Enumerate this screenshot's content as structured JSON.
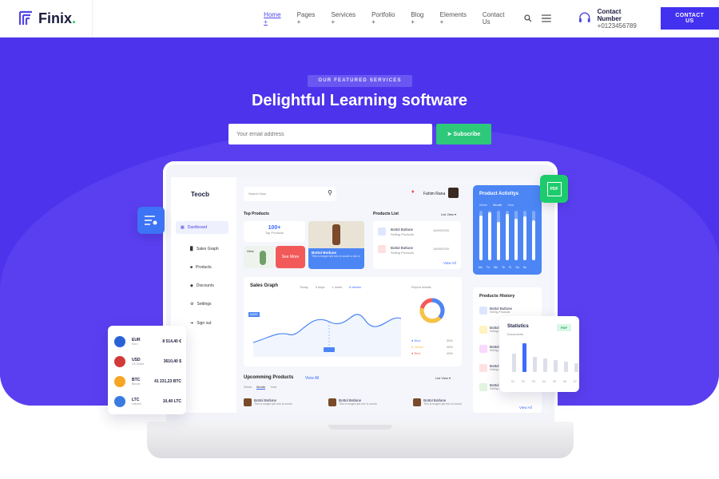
{
  "nav": {
    "brand": "Finix",
    "brand_dot": ".",
    "items": [
      "Home +",
      "Pages +",
      "Services +",
      "Portfolio +",
      "Blog +",
      "Elements +",
      "Contact Us"
    ],
    "contact_title": "Contact Number",
    "contact_phone": "+0123456789",
    "cta": "CONTACT US"
  },
  "hero": {
    "badge": "OUR FEATURED SERVICES",
    "title": "Delightful Learning software",
    "email_placeholder": "Your email address",
    "subscribe": "Subscribe"
  },
  "dash": {
    "brand": "Teocb",
    "sidebar": [
      "Dashboard",
      "Sales Graph",
      "Products",
      "Discounts",
      "Settings",
      "Sign out"
    ],
    "search": "Search Now",
    "user": "Fahim Rana",
    "top_products": "Top Products",
    "top_count": "100+",
    "top_label": "Top Products",
    "view_btn": "View",
    "see_more": "See More",
    "bottle_title": "Bottol Botlune",
    "bottle_desc": "This is tosgeo ipb tolo is sourlo a tolo is",
    "products_list": "Products List",
    "list_view": "List View",
    "list_items": [
      {
        "name": "Bottol Botlune",
        "sub": "Selling Products",
        "date": "16/09/2020"
      },
      {
        "name": "Bottol Botlune",
        "sub": "Selling Products",
        "date": "16/09/2020"
      }
    ],
    "view_all": "View All",
    "sales_graph": "Sales Graph",
    "sales_tabs": [
      "Today",
      "3 days",
      "1 week",
      "6 weeks"
    ],
    "value_label": "$4800",
    "legend": [
      "Blue",
      "Yellow",
      "Red"
    ],
    "legend_pct": [
      "35%",
      "45%",
      "45%"
    ],
    "report": "Report details",
    "upcoming": "Upcomming Products",
    "upcoming_view_all": "View All",
    "upcoming_tabs": [
      "Week",
      "Month",
      "Year"
    ],
    "upcoming_items": [
      "Bottol Botlune",
      "Bottol Botlune",
      "Bottol Botlune"
    ],
    "upcoming_desc": "This is tosgeo ipb tolo is sourlo",
    "activity": "Product Activitys",
    "activity_tabs": [
      "Week",
      "Month",
      "Year"
    ],
    "activity_days": [
      "Mo",
      "Tu",
      "We",
      "Th",
      "Fr",
      "Sa",
      "Su"
    ],
    "history": "Products History",
    "history_items": [
      "Bottol Botlune",
      "Bottol Botlune",
      "Bottol Botlune",
      "Bottol Botlune",
      "Bottol Botlune"
    ],
    "history_sub": "Selling Products"
  },
  "currency": [
    {
      "code": "EUR",
      "name": "Euro",
      "value": "8 514,40 €",
      "color": "#2a62d6"
    },
    {
      "code": "USD",
      "name": "US Dollar",
      "value": "3610,40 $",
      "color": "#d23a3a"
    },
    {
      "code": "BTC",
      "name": "Bitcoin",
      "value": "41 231,23 BTC",
      "color": "#f6a623"
    },
    {
      "code": "LTC",
      "name": "Litecoin",
      "value": "10,40 LTC",
      "color": "#3a7be0"
    }
  ],
  "stats": {
    "title": "Statistics",
    "sub": "Documents",
    "pdf": "PDF",
    "days": [
      "01",
      "02",
      "03",
      "04",
      "05",
      "06",
      "07"
    ],
    "values": [
      55,
      85,
      45,
      40,
      35,
      30,
      25
    ]
  },
  "pdf_icon": "PDF",
  "colors": {
    "primary": "#4d33ec",
    "accent": "#2ec87a",
    "cta": "#4331f0",
    "chart": "#4c86f5"
  }
}
